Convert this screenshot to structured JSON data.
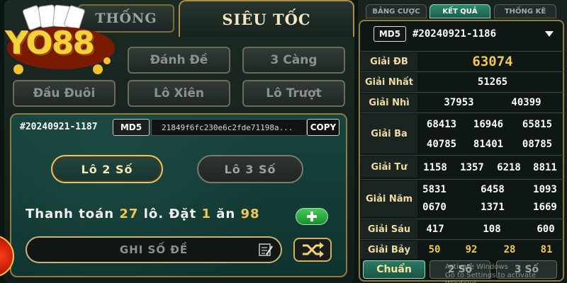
{
  "left": {
    "logo_text": "YO88",
    "tab_thong": "THỐNG",
    "tab_sieu_toc": "SIÊU TỐC",
    "options": [
      "Đánh Đề",
      "3 Càng",
      "Đầu Đuôi",
      "Lô Xiên",
      "Lô Trượt"
    ],
    "round_id": "#20240921-1187",
    "md5_label": "MD5",
    "md5_hash": "21849f6fc230e6c2fde71198a...",
    "copy_label": "COPY",
    "lo2_label": "Lô 2 Số",
    "lo3_label": "Lô 3 Số",
    "pay": {
      "prefix": "Thanh toán",
      "count": "27",
      "mid1": "lô. Đặt",
      "bet": "1",
      "mid2": "ăn",
      "win": "98"
    },
    "input_placeholder": "GHI SỐ ĐỀ"
  },
  "right": {
    "tabs": [
      "BẢNG CƯỢC",
      "KẾT QUẢ",
      "THỐNG KÊ"
    ],
    "active_tab": "KẾT QUẢ",
    "md5_label": "MD5",
    "selected_round": "#20240921-1186",
    "prizes": {
      "db": {
        "label": "Giải ĐB",
        "values": [
          "63074"
        ]
      },
      "nhat": {
        "label": "Giải Nhất",
        "values": [
          "51265"
        ]
      },
      "nhi": {
        "label": "Giải Nhì",
        "values": [
          "37953",
          "40399"
        ]
      },
      "ba": {
        "label": "Giải Ba",
        "values": [
          "68413",
          "16946",
          "65815",
          "40785",
          "81401",
          "08785"
        ]
      },
      "tu": {
        "label": "Giải Tư",
        "values": [
          "1158",
          "1357",
          "6218",
          "8811"
        ]
      },
      "nam": {
        "label": "Giải Năm",
        "values": [
          "5831",
          "6458",
          "1093",
          "0670",
          "1371",
          "1669"
        ]
      },
      "sau": {
        "label": "Giải Sáu",
        "values": [
          "417",
          "108",
          "600"
        ]
      },
      "bay": {
        "label": "Giải Bảy",
        "values": [
          "50",
          "92",
          "28",
          "81"
        ]
      }
    },
    "bottom_buttons": [
      "Chuẩn",
      "2 Số",
      "3 Số"
    ],
    "watermark": [
      "Activate Windows",
      "Go to Settings to activate Windows."
    ]
  },
  "colors": {
    "gold": "#f2c94c",
    "accent_green": "#2b7a63",
    "border_gold": "#8d7a45"
  }
}
